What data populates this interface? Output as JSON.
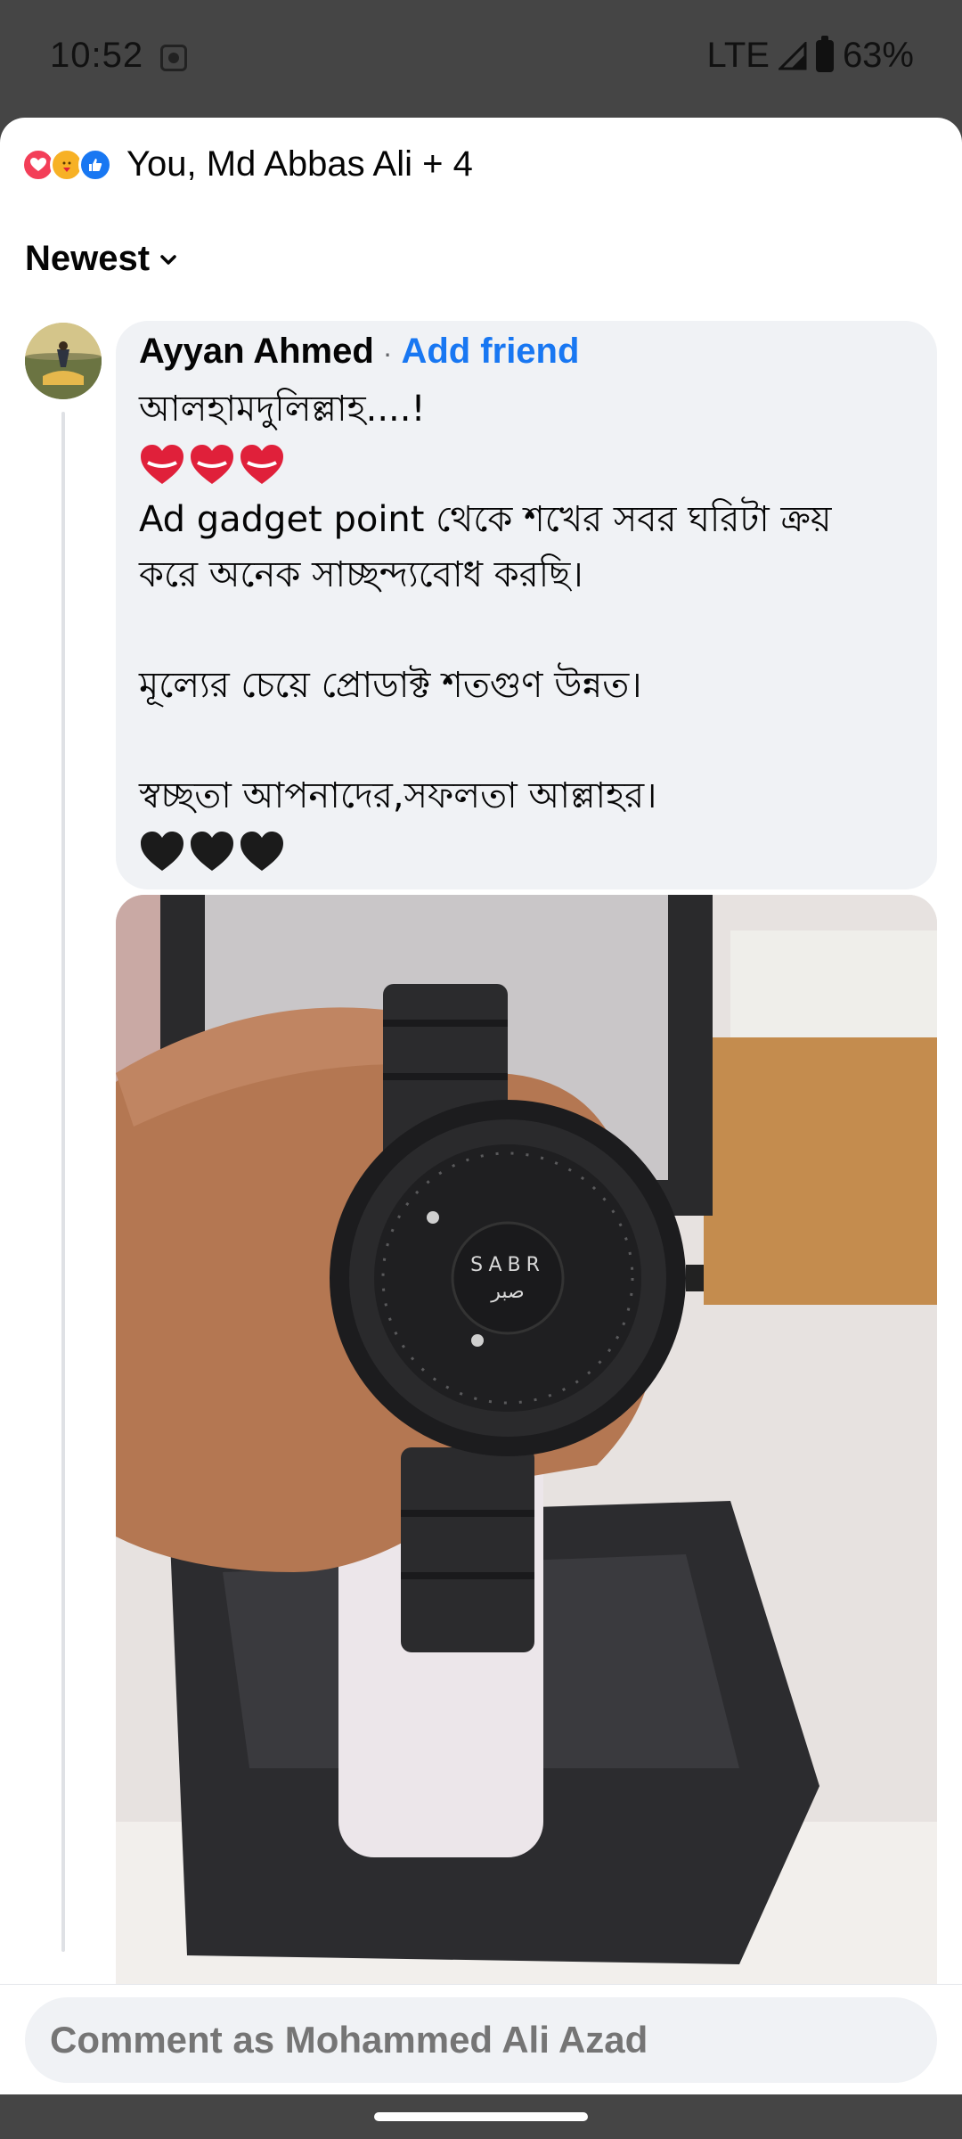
{
  "status_bar": {
    "time": "10:52",
    "network": "LTE",
    "battery": "63%"
  },
  "reactions": {
    "types": [
      "love-icon",
      "care-icon",
      "like-icon"
    ],
    "summary": "You, Md Abbas Ali + 4"
  },
  "sort": {
    "label": "Newest"
  },
  "comment": {
    "author": "Ayyan Ahmed",
    "separator": "·",
    "add_friend": "Add friend",
    "lines": {
      "l1": "আলহামদুলিল্লাহ....!",
      "l3": "Ad gadget point থেকে শখের সবর ঘরিটা ক্রয়",
      "l4": "করে অনেক সাচ্ছন্দ্যবোধ করছি।",
      "l6": "মূল্যের চেয়ে প্রোডাক্ট শতগুণ উন্নত।",
      "l8": "স্বচ্ছতা আপনাদের,সফলতা আল্লাহর।"
    },
    "photo": {
      "watch_brand": "SABR",
      "watch_brand_arabic": "صبر"
    }
  },
  "composer": {
    "placeholder": "Comment as Mohammed Ali Azad"
  },
  "colors": {
    "accent": "#1877f2",
    "love": "#f33e58",
    "bubble": "#f0f2f5"
  }
}
